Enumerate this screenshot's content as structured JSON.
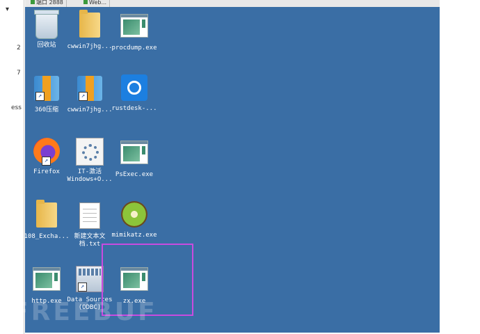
{
  "host": {
    "dropdown_glyph": "▾",
    "left_labels": [
      "2",
      "7",
      "ess"
    ]
  },
  "tabs": [
    {
      "label": "端口 2888"
    },
    {
      "label": "Web..."
    }
  ],
  "desktop": {
    "icons": [
      {
        "label": "回收站",
        "icon": "recycle-bin-icon"
      },
      {
        "label": "cwwin7jhg...",
        "icon": "folder-icon"
      },
      {
        "label": "procdump.exe",
        "icon": "exe-icon"
      },
      {
        "label": "360压缩",
        "icon": "zip-archive-icon"
      },
      {
        "label": "cwwin7jhg...",
        "icon": "zip-archive-icon"
      },
      {
        "label": "rustdesk-...",
        "icon": "rustdesk-icon"
      },
      {
        "label": "Firefox",
        "icon": "firefox-icon"
      },
      {
        "label": "IT-激活\nWindows+O...",
        "icon": "gear-program-icon"
      },
      {
        "label": "PsExec.exe",
        "icon": "exe-icon"
      },
      {
        "label": "108_Excha...",
        "icon": "folder-icon"
      },
      {
        "label": "新建文本文\n档.txt",
        "icon": "text-document-icon"
      },
      {
        "label": "mimikatz.exe",
        "icon": "kiwi-icon"
      },
      {
        "label": "http.exe",
        "icon": "exe-icon"
      },
      {
        "label": "Data Sources\n(ODBC)",
        "icon": "data-sources-icon"
      },
      {
        "label": "zx.exe",
        "icon": "exe-icon"
      }
    ]
  },
  "highlight_color": "#c94be0",
  "watermark": "FREEBUF"
}
